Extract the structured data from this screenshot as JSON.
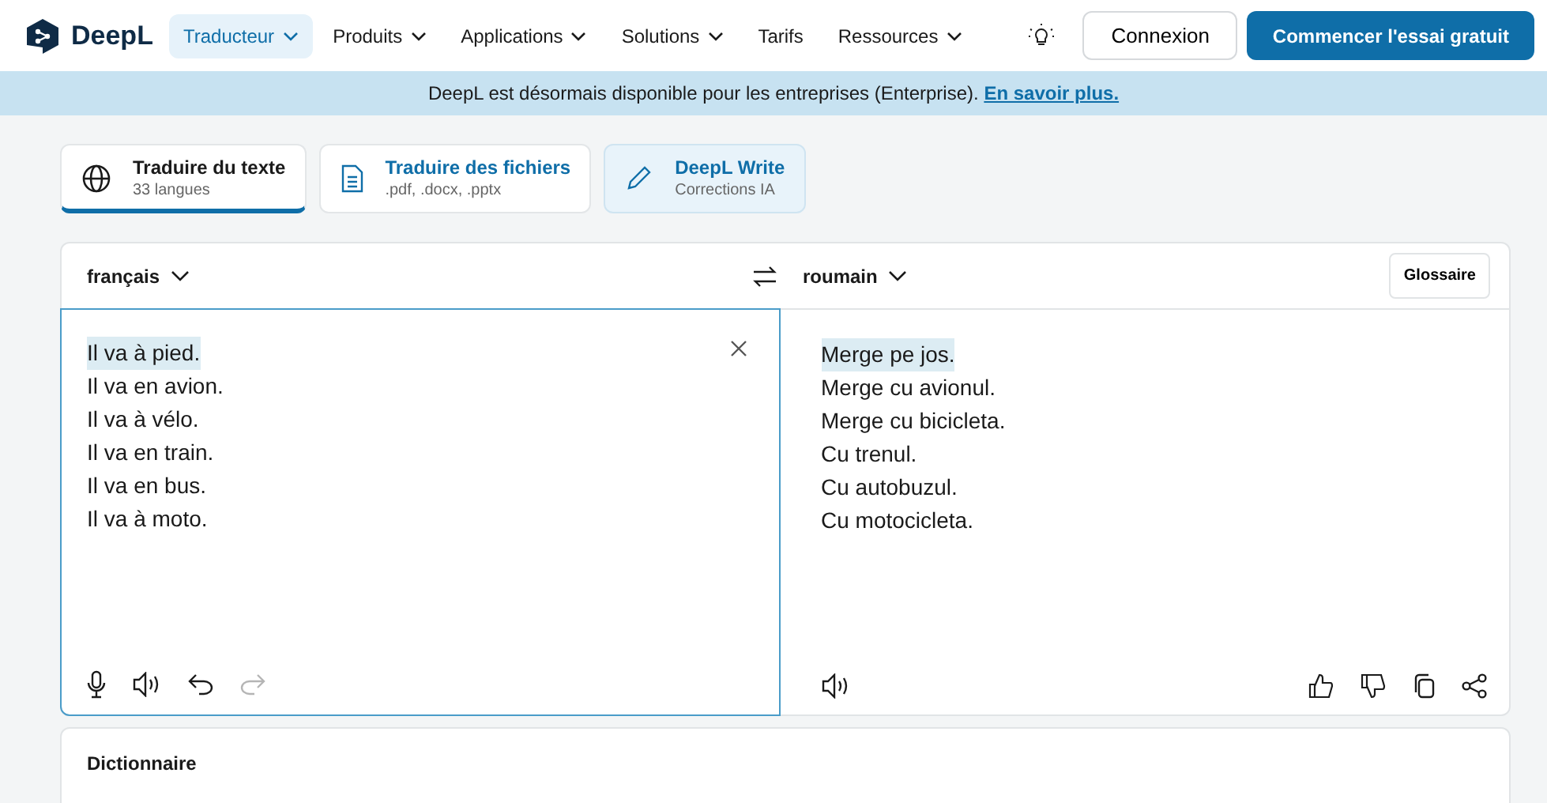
{
  "header": {
    "logo": "DeepL",
    "nav": [
      {
        "label": "Traducteur",
        "selected": true,
        "dropdown": true
      },
      {
        "label": "Produits",
        "selected": false,
        "dropdown": true
      },
      {
        "label": "Applications",
        "selected": false,
        "dropdown": true
      },
      {
        "label": "Solutions",
        "selected": false,
        "dropdown": true
      },
      {
        "label": "Tarifs",
        "selected": false,
        "dropdown": false
      },
      {
        "label": "Ressources",
        "selected": false,
        "dropdown": true
      }
    ],
    "login": "Connexion",
    "cta": "Commencer l'essai gratuit"
  },
  "banner": {
    "text": "DeepL est désormais disponible pour les entreprises (Enterprise).",
    "link": "En savoir plus."
  },
  "modes": [
    {
      "kind": "globe",
      "title": "Traduire du texte",
      "subtitle": "33 langues",
      "selected": true
    },
    {
      "kind": "file",
      "title": "Traduire des fichiers",
      "subtitle": ".pdf, .docx, .pptx",
      "selected": false
    },
    {
      "kind": "pen",
      "title": "DeepL Write",
      "subtitle": "Corrections IA",
      "selected": false
    }
  ],
  "translator": {
    "source_language": "français",
    "target_language": "roumain",
    "glossary": "Glossaire",
    "source_lines": [
      {
        "text": "Il va à pied.",
        "highlighted": true
      },
      {
        "text": "Il va en avion.",
        "highlighted": false
      },
      {
        "text": "Il va à vélo.",
        "highlighted": false
      },
      {
        "text": "Il va en train.",
        "highlighted": false
      },
      {
        "text": "Il va en bus.",
        "highlighted": false
      },
      {
        "text": "Il va à moto.",
        "highlighted": false
      }
    ],
    "target_lines": [
      {
        "text": "Merge pe jos.",
        "highlighted": true
      },
      {
        "text": "Merge cu avionul.",
        "highlighted": false
      },
      {
        "text": "Merge cu bicicleta.",
        "highlighted": false
      },
      {
        "text": "Cu trenul.",
        "highlighted": false
      },
      {
        "text": "Cu autobuzul.",
        "highlighted": false
      },
      {
        "text": "Cu motocicleta.",
        "highlighted": false
      }
    ],
    "redo_disabled": true
  },
  "dictionary": {
    "title": "Dictionnaire"
  }
}
